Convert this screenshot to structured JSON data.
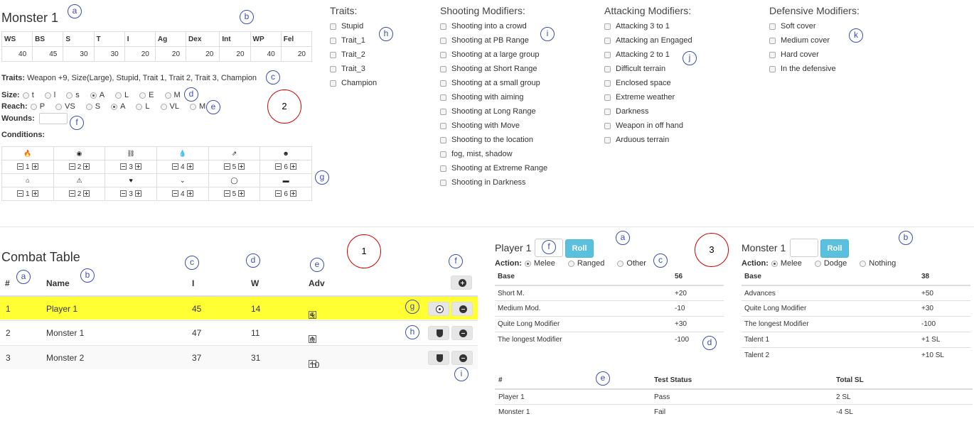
{
  "monster": {
    "title": "Monster 1",
    "stats": {
      "headers": [
        "WS",
        "BS",
        "S",
        "T",
        "I",
        "Ag",
        "Dex",
        "Int",
        "WP",
        "Fel"
      ],
      "values": [
        "40",
        "45",
        "30",
        "30",
        "20",
        "20",
        "20",
        "20",
        "40",
        "20"
      ]
    },
    "traits_label": "Traits:",
    "traits_text": "Weapon +9, Size(Large), Stupid, Trait 1, Trait 2, Trait 3, Champion",
    "size_label": "Size:",
    "size_options": [
      "t",
      "l",
      "s",
      "A",
      "L",
      "E",
      "M"
    ],
    "size_selected": "A",
    "reach_label": "Reach:",
    "reach_options": [
      "P",
      "VS",
      "S",
      "A",
      "L",
      "VL",
      "M"
    ],
    "reach_selected": "A",
    "wounds_label": "Wounds:",
    "wounds_value": "",
    "conditions_label": "Conditions:",
    "conditions_row1": [
      {
        "icon": "fire-icon",
        "glyph": "🔥",
        "value": "1"
      },
      {
        "icon": "eye-slash-icon",
        "glyph": "◉",
        "value": "2"
      },
      {
        "icon": "link-icon",
        "glyph": "⛓",
        "value": "3"
      },
      {
        "icon": "blood-drop-icon",
        "glyph": "💧",
        "value": "4"
      },
      {
        "icon": "running-icon",
        "glyph": "⇗",
        "value": "5"
      },
      {
        "icon": "skull-icon",
        "glyph": "☻",
        "value": "6"
      }
    ],
    "conditions_row2": [
      {
        "icon": "home-icon",
        "glyph": "⌂",
        "value": "1"
      },
      {
        "icon": "warning-icon",
        "glyph": "⚠",
        "value": "2"
      },
      {
        "icon": "heartbeat-icon",
        "glyph": "♥",
        "value": "3"
      },
      {
        "icon": "chevron-down-icon",
        "glyph": "⌄",
        "value": "4"
      },
      {
        "icon": "speech-bubble-icon",
        "glyph": "◯",
        "value": "5"
      },
      {
        "icon": "bed-icon",
        "glyph": "▬",
        "value": "6"
      }
    ]
  },
  "traits_panel": {
    "title": "Traits:",
    "items": [
      "Stupid",
      "Trait_1",
      "Trait_2",
      "Trait_3",
      "Champion"
    ]
  },
  "shooting_panel": {
    "title": "Shooting Modifiers:",
    "items": [
      "Shooting into a crowd",
      "Shooting at PB Range",
      "Shooting at a large group",
      "Shooting at Short Range",
      "Shooting at a small group",
      "Shooting with aiming",
      "Shooting at Long Range",
      "Shooting with Move",
      "Shooting to the location",
      "fog, mist, shadow",
      "Shooting at Extreme Range",
      "Shooting in Darkness"
    ]
  },
  "attacking_panel": {
    "title": "Attacking Modifiers:",
    "items": [
      "Attacking 3 to 1",
      "Attacking an Engaged",
      "Attacking 2 to 1",
      "Difficult terrain",
      "Enclosed space",
      "Extreme weather",
      "Darkness",
      "Weapon in off hand",
      "Arduous terrain"
    ]
  },
  "defensive_panel": {
    "title": "Defensive Modifiers:",
    "items": [
      "Soft cover",
      "Medium cover",
      "Hard cover",
      "In the defensive"
    ]
  },
  "combat": {
    "title": "Combat Table",
    "headers": {
      "num": "#",
      "name": "Name",
      "i": "I",
      "w": "W",
      "adv": "Adv"
    },
    "rows": [
      {
        "num": "1",
        "name": "Player 1",
        "i": "45",
        "w": "14",
        "adv": "5"
      },
      {
        "num": "2",
        "name": "Monster 1",
        "i": "47",
        "w": "11",
        "adv": "0"
      },
      {
        "num": "3",
        "name": "Monster 2",
        "i": "37",
        "w": "31",
        "adv": "10"
      }
    ],
    "highlight_color": "#ffff33"
  },
  "attacker": {
    "name": "Player 1",
    "roll_label": "Roll",
    "action_label": "Action:",
    "actions": [
      "Melee",
      "Ranged",
      "Other"
    ],
    "action_selected": "Melee",
    "base_label": "Base",
    "base_value": "56",
    "mods": [
      {
        "name": "Short M.",
        "value": "+20"
      },
      {
        "name": "Medium Mod.",
        "value": "-10"
      },
      {
        "name": "Quite Long Modifier",
        "value": "+30"
      },
      {
        "name": "The longest Modifier",
        "value": "-100"
      }
    ]
  },
  "defender": {
    "name": "Monster 1",
    "roll_label": "Roll",
    "action_label": "Action:",
    "actions": [
      "Melee",
      "Dodge",
      "Nothing"
    ],
    "action_selected": "Melee",
    "base_label": "Base",
    "base_value": "38",
    "mods": [
      {
        "name": "Advances",
        "value": "+50"
      },
      {
        "name": "Quite Long Modifier",
        "value": "+30"
      },
      {
        "name": "The longest Modifier",
        "value": "-100"
      },
      {
        "name": "Talent 1",
        "value": "+1 SL"
      },
      {
        "name": "Talent 2",
        "value": "+10 SL"
      }
    ]
  },
  "results": {
    "headers": {
      "num": "#",
      "status": "Test Status",
      "sl": "Total SL"
    },
    "rows": [
      {
        "name": "Player 1",
        "status": "Pass",
        "sl": "2 SL"
      },
      {
        "name": "Monster 1",
        "status": "Fail",
        "sl": "-4 SL"
      }
    ]
  },
  "annotations": {
    "blue_top": [
      "a",
      "b",
      "c",
      "d",
      "e",
      "f",
      "g",
      "h",
      "i",
      "j",
      "k"
    ],
    "blue_combat": [
      "a",
      "b",
      "c",
      "d",
      "e",
      "f",
      "g",
      "h",
      "i"
    ],
    "blue_roll": [
      "a",
      "b",
      "c",
      "d",
      "e",
      "f"
    ],
    "red": [
      "1",
      "2",
      "3"
    ]
  },
  "colors": {
    "roll_button": "#5bc0de",
    "marker_blue": "#3a4db0",
    "marker_red": "#cc0000"
  }
}
